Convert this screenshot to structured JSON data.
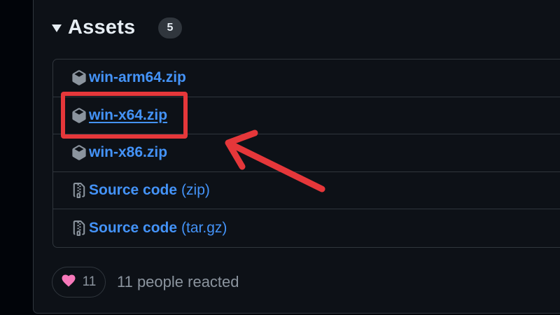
{
  "assets": {
    "title": "Assets",
    "count": "5",
    "items": [
      {
        "name": "win-arm64.zip",
        "suffix": "",
        "icon": "package-icon"
      },
      {
        "name": "win-x64.zip",
        "suffix": "",
        "icon": "package-icon"
      },
      {
        "name": "win-x86.zip",
        "suffix": "",
        "icon": "package-icon"
      },
      {
        "name": "Source code",
        "suffix": "(zip)",
        "icon": "file-zip-icon"
      },
      {
        "name": "Source code",
        "suffix": "(tar.gz)",
        "icon": "file-zip-icon"
      }
    ]
  },
  "reactions": {
    "emoji_icon": "heart-icon",
    "count": "11",
    "summary": "11 people reacted"
  },
  "annotation": {
    "highlight_color": "#e5373a",
    "highlighted_item": "win-x64.zip"
  },
  "colors": {
    "link": "#4493f8",
    "background": "#0d1117",
    "border": "#30363d"
  }
}
